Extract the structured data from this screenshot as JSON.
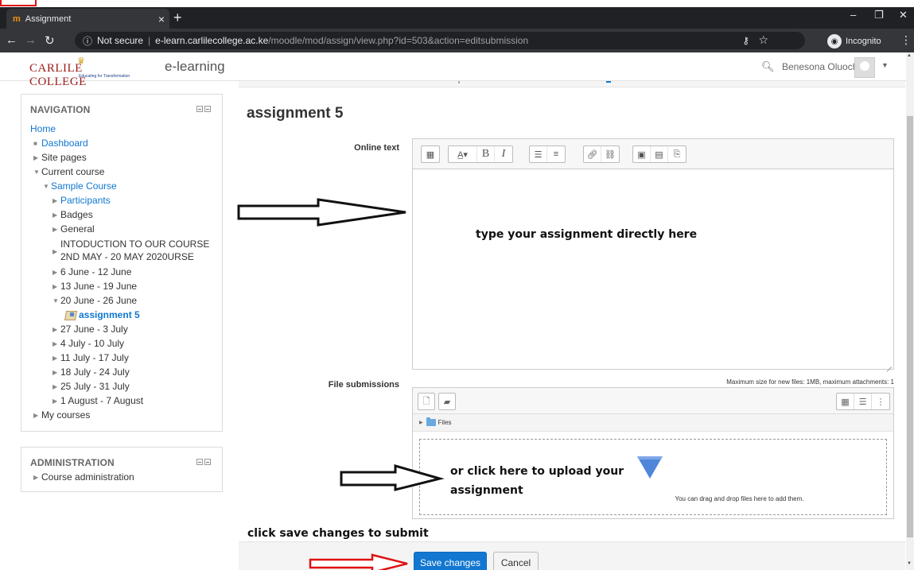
{
  "browser": {
    "tab_title": "Assignment",
    "tab_icon": "m",
    "address_info": "Not secure",
    "address_host": "e-learn.carlilecollege.ac.ke",
    "address_path": "/moodle/mod/assign/view.php?id=503&action=editsubmission",
    "incognito_label": "Incognito"
  },
  "header": {
    "logo_text": "CARLILE COLLEGE",
    "logo_tagline": "Educating for Transformation",
    "site_name": "e-learning",
    "user_name": "Benesona Oluoch"
  },
  "navigation": {
    "title": "NAVIGATION",
    "home": "Home",
    "items": [
      {
        "label": "Dashboard",
        "toggle": "■",
        "link": true
      },
      {
        "label": "Site pages",
        "toggle": "▶",
        "link": false
      },
      {
        "label": "Current course",
        "toggle": "▼",
        "link": false
      },
      {
        "label": "Sample Course",
        "toggle": "▼",
        "link": true
      },
      {
        "label": "Participants",
        "toggle": "▶",
        "link": true
      },
      {
        "label": "Badges",
        "toggle": "▶",
        "link": false
      },
      {
        "label": "General",
        "toggle": "▶",
        "link": false
      },
      {
        "label": "INTODUCTION TO OUR COURSE 2ND MAY - 20 MAY 2020URSE",
        "toggle": "▶",
        "link": false
      },
      {
        "label": "6 June - 12 June",
        "toggle": "▶",
        "link": false
      },
      {
        "label": "13 June - 19 June",
        "toggle": "▶",
        "link": false
      },
      {
        "label": "20 June - 26 June",
        "toggle": "▼",
        "link": false
      },
      {
        "label": "assignment 5",
        "toggle": "",
        "link": true
      },
      {
        "label": "27 June - 3 July",
        "toggle": "▶",
        "link": false
      },
      {
        "label": "4 July - 10 July",
        "toggle": "▶",
        "link": false
      },
      {
        "label": "11 July - 17 July",
        "toggle": "▶",
        "link": false
      },
      {
        "label": "18 July - 24 July",
        "toggle": "▶",
        "link": false
      },
      {
        "label": "25 July - 31 July",
        "toggle": "▶",
        "link": false
      },
      {
        "label": "1 August - 7 August",
        "toggle": "▶",
        "link": false
      },
      {
        "label": "My courses",
        "toggle": "▶",
        "link": false
      }
    ]
  },
  "administration": {
    "title": "ADMINISTRATION",
    "item": "Course administration"
  },
  "main": {
    "heading": "assignment 5",
    "online_text_label": "Online text",
    "file_submissions_label": "File submissions",
    "max_size_note": "Maximum size for new files: 1MB, maximum attachments: 1",
    "files_folder": "Files",
    "drop_hint": "You can drag and drop files here to add them.",
    "save_label": "Save changes",
    "cancel_label": "Cancel"
  },
  "annotations": {
    "type_here": "type your assignment directly here",
    "upload_line1": "or click here to upload your",
    "upload_line2": "assignment",
    "save_hint": "click save changes to submit"
  },
  "colors": {
    "link": "#1177d1",
    "primary_button": "#1177d1",
    "annotation_arrow_red": "#e01010"
  }
}
